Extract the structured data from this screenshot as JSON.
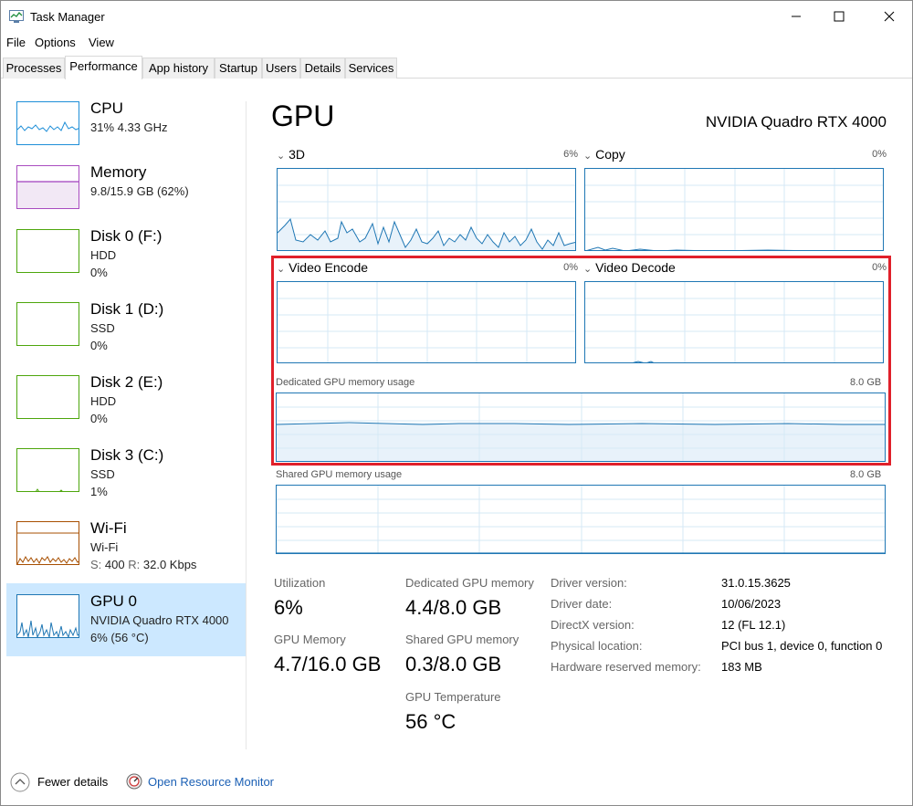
{
  "window": {
    "title": "Task Manager",
    "controls": [
      "minimize",
      "maximize",
      "close"
    ]
  },
  "menu": [
    "File",
    "Options",
    "View"
  ],
  "tabs": [
    "Processes",
    "Performance",
    "App history",
    "Startup",
    "Users",
    "Details",
    "Services"
  ],
  "active_tab": "Performance",
  "sidebar": {
    "items": [
      {
        "name": "CPU",
        "line1": "31%  4.33 GHz",
        "line2": ""
      },
      {
        "name": "Memory",
        "line1": "9.8/15.9 GB (62%)",
        "line2": ""
      },
      {
        "name": "Disk 0 (F:)",
        "line1": "HDD",
        "line2": "0%"
      },
      {
        "name": "Disk 1 (D:)",
        "line1": "SSD",
        "line2": "0%"
      },
      {
        "name": "Disk 2 (E:)",
        "line1": "HDD",
        "line2": "0%"
      },
      {
        "name": "Disk 3 (C:)",
        "line1": "SSD",
        "line2": "1%"
      },
      {
        "name": "Wi-Fi",
        "line1": "Wi-Fi",
        "line2_s_label": "S:",
        "line2_s_value": "400",
        "line2_r_label": "R:",
        "line2_r_value": "32.0 Kbps"
      },
      {
        "name": "GPU 0",
        "line1": "NVIDIA Quadro RTX 4000",
        "line2": "6% (56 °C)"
      }
    ],
    "selected": "GPU 0"
  },
  "main": {
    "title": "GPU",
    "model": "NVIDIA Quadro RTX 4000",
    "engines": [
      {
        "label": "3D",
        "value": "6%"
      },
      {
        "label": "Copy",
        "value": "0%"
      },
      {
        "label": "Video Encode",
        "value": "0%"
      },
      {
        "label": "Video Decode",
        "value": "0%"
      }
    ],
    "dedicated_label": "Dedicated GPU memory usage",
    "dedicated_max": "8.0 GB",
    "shared_label": "Shared GPU memory usage",
    "shared_max": "8.0 GB"
  },
  "stats": {
    "utilization_label": "Utilization",
    "utilization_value": "6%",
    "gpu_memory_label": "GPU Memory",
    "gpu_memory_value": "4.7/16.0 GB",
    "dedicated_label": "Dedicated GPU memory",
    "dedicated_value": "4.4/8.0 GB",
    "shared_label": "Shared GPU memory",
    "shared_value": "0.3/8.0 GB",
    "temp_label": "GPU Temperature",
    "temp_value": "56 °C"
  },
  "info": [
    {
      "label": "Driver version:",
      "value": "31.0.15.3625"
    },
    {
      "label": "Driver date:",
      "value": "10/06/2023"
    },
    {
      "label": "DirectX version:",
      "value": "12 (FL 12.1)"
    },
    {
      "label": "Physical location:",
      "value": "PCI bus 1, device 0, function 0"
    },
    {
      "label": "Hardware reserved memory:",
      "value": "183 MB"
    }
  ],
  "footer": {
    "fewer_details": "Fewer details",
    "open_resource_monitor": "Open Resource Monitor"
  },
  "colors": {
    "gpu_accent": "#1f77b4",
    "cpu_accent": "#1f8fd8",
    "memory_accent": "#8b12ae",
    "disk_accent": "#4da60c",
    "wifi_accent": "#a74f01",
    "selection": "#cce8ff",
    "highlight_box": "#e0202a"
  }
}
